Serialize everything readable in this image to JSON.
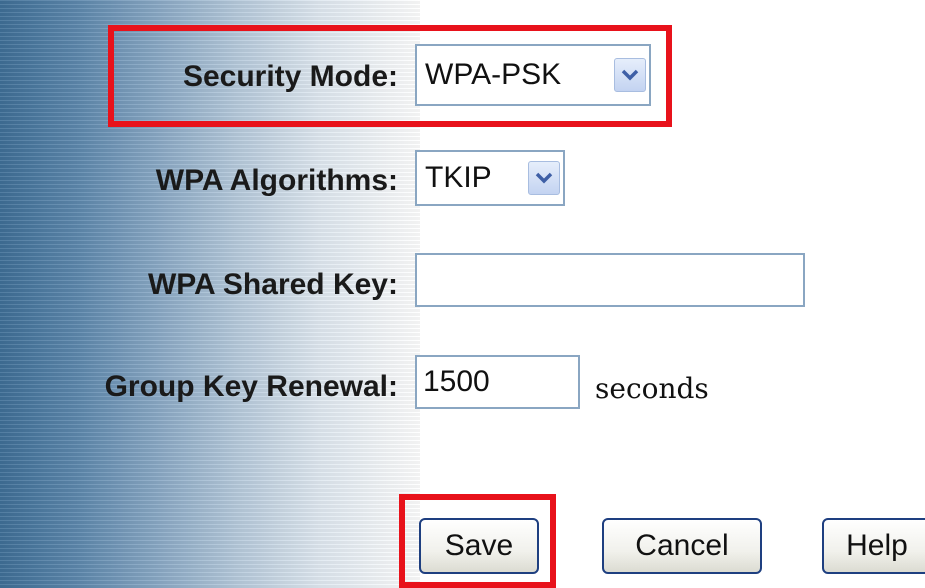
{
  "form": {
    "security_mode": {
      "label": "Security Mode:",
      "value": "WPA-PSK",
      "dropdown_icon": "chevron-down-icon"
    },
    "wpa_algorithms": {
      "label": "WPA Algorithms:",
      "value": "TKIP",
      "dropdown_icon": "chevron-down-icon"
    },
    "wpa_shared_key": {
      "label": "WPA Shared Key:",
      "value": ""
    },
    "group_key_renewal": {
      "label": "Group Key Renewal:",
      "value": "1500",
      "unit": "seconds"
    }
  },
  "buttons": {
    "save_label": "Save",
    "cancel_label": "Cancel",
    "help_label": "Help"
  },
  "colors": {
    "highlight": "#e8121b",
    "button_border": "#1e3f80",
    "field_border": "#8aa6c2",
    "panel_gradient_start": "#3f6f97"
  }
}
